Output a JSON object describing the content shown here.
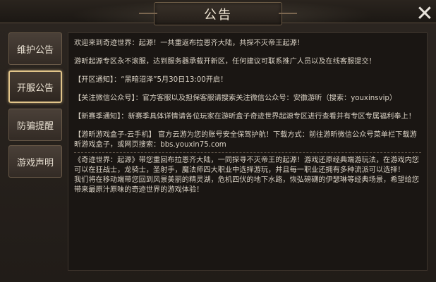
{
  "dialog": {
    "title": "公告",
    "close_glyph": "✕"
  },
  "sidebar": {
    "tabs": [
      {
        "label": "维护公告",
        "active": false
      },
      {
        "label": "开服公告",
        "active": true
      },
      {
        "label": "防骗提醒",
        "active": false
      },
      {
        "label": "游戏声明",
        "active": false
      }
    ]
  },
  "content": {
    "paragraphs": [
      "欢迎来到奇迹世界：起源！一共重返布拉恩齐大陆，共探不灭帝王起源！",
      "游昕起源专区永不滚服，达到服务器承载开新区，任何建议可联系推广人员以及在线客服提交！",
      "【开区通知】：“黑暗沼泽”5月30日13:00开启！",
      "【关注微信公众号】：官方客服以及担保客服请搜索关注微信公众号：安徽游昕（搜索：youxinsvip）",
      "【新赛季通知】：新赛季具体详情请各位玩家在游昕盒子奇迹世界起源专区进行查看并有专区专属福利奉上！",
      "【游昕游戏盒子-云手机】 官方云游为您的账号安全保驾护航！下载方式：前往游昕微信公众号菜单栏下载游昕游戏盒子，或网页搜索：bbs.youxin75.com"
    ],
    "intro": [
      "《奇迹世界：起源》带您重回布拉恩齐大陆，一同探寻不灭帝王的起源！游戏还原经典端游玩法，在游戏内您可以在狂战士，龙骑士，圣射手，魔法师四大职业中选择游玩，并且每一职业还拥有多种流派可以选择！",
      "我们将在移动端带您回到风景美丽的精灵湖，危机四伏的地下水路，恢弘磅礴的伊瑟琳等经典场景，希望给您带来最原汁原味的奇迹世界的游戏体验！"
    ]
  },
  "colors": {
    "accent_gold": "#e2c58a",
    "panel_bg": "#2b2520",
    "content_bg": "#1a1613",
    "text": "#d9d1c4"
  },
  "icons": {
    "close": "close-icon"
  }
}
